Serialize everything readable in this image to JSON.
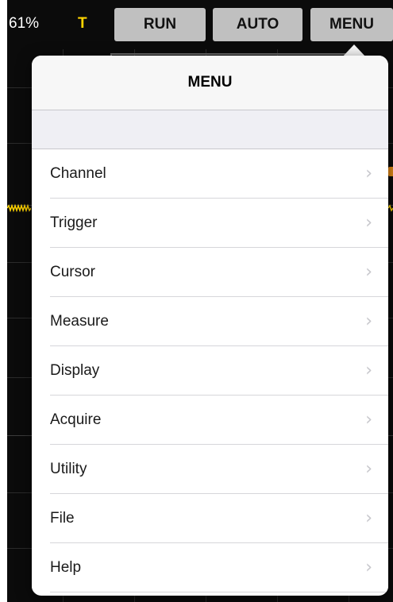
{
  "topbar": {
    "battery": "61%",
    "trigger_indicator": "T",
    "buttons": {
      "run": "RUN",
      "auto": "AUTO",
      "menu": "MENU"
    }
  },
  "popover": {
    "title": "MENU",
    "items": [
      {
        "label": "Channel",
        "chevron": "›"
      },
      {
        "label": "Trigger",
        "chevron": "›"
      },
      {
        "label": "Cursor",
        "chevron": "›"
      },
      {
        "label": "Measure",
        "chevron": "›"
      },
      {
        "label": "Display",
        "chevron": "›"
      },
      {
        "label": "Acquire",
        "chevron": "›"
      },
      {
        "label": "Utility",
        "chevron": "›"
      },
      {
        "label": "File",
        "chevron": "›"
      },
      {
        "label": "Help",
        "chevron": "›"
      }
    ]
  },
  "colors": {
    "trace": "#ffd400",
    "trigger_marker": "#e38a18",
    "button_bg": "#c0c0c0",
    "screen_bg": "#0b0b0b"
  }
}
